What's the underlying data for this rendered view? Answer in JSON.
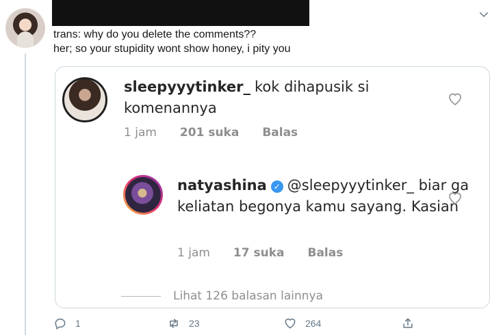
{
  "tweet": {
    "lines": [
      "trans: why do you delete the comments??",
      "her; so your stupidity wont show honey, i pity you"
    ]
  },
  "icons": {
    "caret": "chevron-down-icon",
    "reply": "reply-icon",
    "retweet": "retweet-icon",
    "like": "heart-icon",
    "share": "share-icon"
  },
  "embed": {
    "comment1": {
      "username": "sleepyyytinker_",
      "text": "kok dihapusik si komenannya",
      "time": "1 jam",
      "likes": "201 suka",
      "reply": "Balas"
    },
    "comment2": {
      "username": "natyashina",
      "verified_mark": "✓",
      "mention": "@sleepyyytinker_",
      "text": "biar ga keliatan begonya kamu sayang. Kasian",
      "time": "1 jam",
      "likes": "17 suka",
      "reply": "Balas"
    },
    "view_more": "Lihat 126 balasan lainnya"
  },
  "actions": {
    "reply_count": "1",
    "retweet_count": "23",
    "like_count": "264"
  },
  "colors": {
    "twitter_gray": "#657786",
    "ig_gray": "#8e8e8e",
    "verified_blue": "#3897f0"
  }
}
